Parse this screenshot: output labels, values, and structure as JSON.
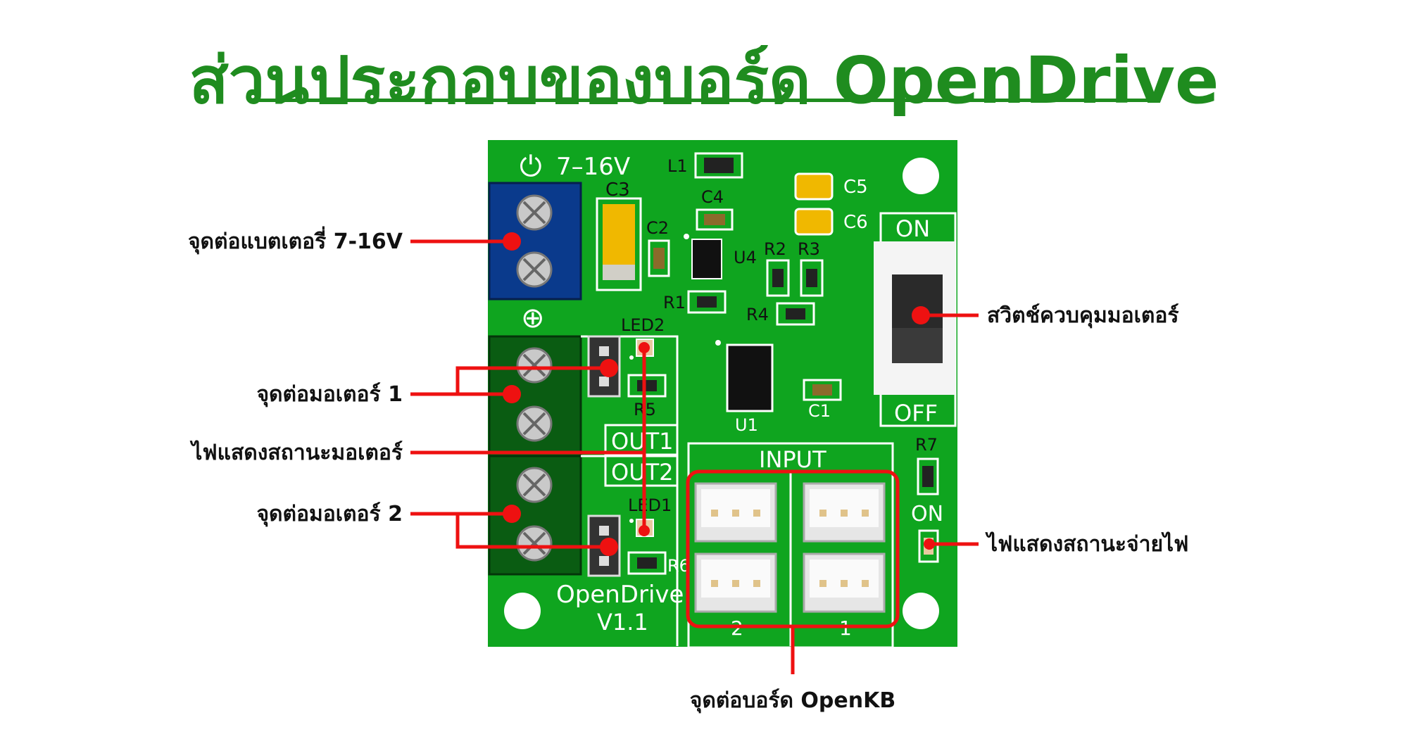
{
  "title": "ส่วนประกอบของบอร์ด OpenDrive",
  "colors": {
    "pcb": "#0fa51f",
    "terminal_blue": "#0a3a8c",
    "terminal_green": "#0a5c12",
    "callout_line": "#ee1111",
    "title": "#1f8c1f"
  },
  "board": {
    "power_symbol": "⏻",
    "voltage": "7–16V",
    "plus_symbol": "⊕",
    "name": "OpenDrive",
    "version": "V1.1",
    "components": {
      "l1": "L1",
      "c3": "C3",
      "c4": "C4",
      "c2": "C2",
      "c5": "C5",
      "c6": "C6",
      "u4": "U4",
      "r1": "R1",
      "r2": "R2",
      "r3": "R3",
      "r4": "R4",
      "led2": "LED2",
      "led1": "LED1",
      "r5": "R5",
      "r6": "R6",
      "u1": "U1",
      "c1": "C1",
      "r7": "R7"
    },
    "out1": "OUT1",
    "out2": "OUT2",
    "input_label": "INPUT",
    "input_2": "2",
    "input_1": "1",
    "switch_on": "ON",
    "switch_off": "OFF",
    "power_on": "ON"
  },
  "callouts": {
    "battery": "จุดต่อแบตเตอรี่ 7-16V",
    "motor1": "จุดต่อมอเตอร์ 1",
    "motor_led": "ไฟแสดงสถานะมอเตอร์",
    "motor2": "จุดต่อมอเตอร์ 2",
    "switch": "สวิตช์ควบคุมมอเตอร์",
    "power_led": "ไฟแสดงสถานะจ่ายไฟ",
    "openkb": "จุดต่อบอร์ด OpenKB"
  }
}
